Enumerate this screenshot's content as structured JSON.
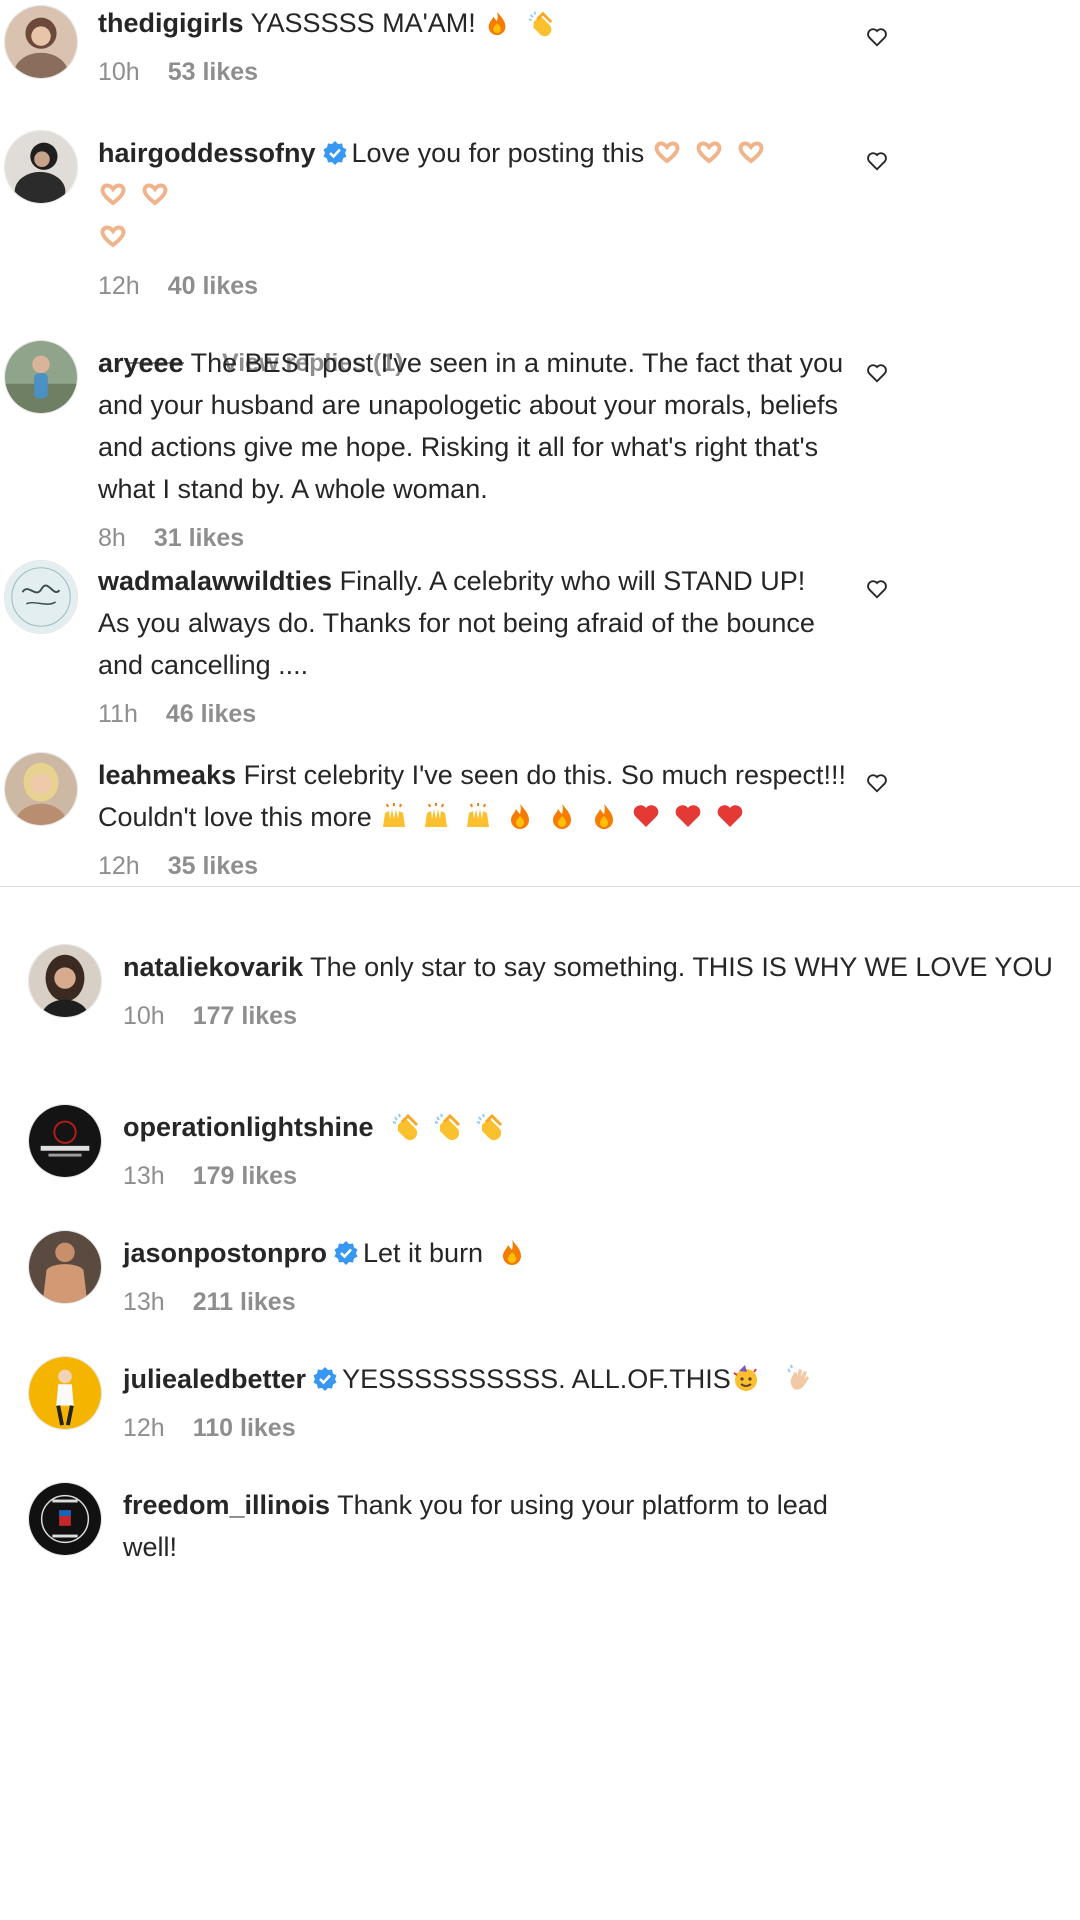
{
  "comments_top": [
    {
      "username": "thedigigirls",
      "verified": false,
      "text": "YASSSSS MA'AM!",
      "emojis": [
        "fire",
        "clap"
      ],
      "time": "10h",
      "likes": "53 likes",
      "avatar_icon": "avatar-woman-portrait"
    },
    {
      "username": "hairgoddessofny",
      "verified": true,
      "text": "Love you for posting this",
      "emojis": [
        "heart-hands",
        "heart-hands",
        "heart-hands",
        "heart-hands",
        "heart-hands",
        "heart-hands"
      ],
      "time": "12h",
      "likes": "40 likes",
      "avatar_icon": "avatar-woman-dark"
    },
    {
      "username": "aryeee",
      "verified": false,
      "text": "The BEST post I've seen in a minute. The fact that you and your husband are unapologetic about your morals, beliefs and actions give me hope. Risking it all for what's right that's what I stand by. A whole woman.",
      "emojis": [],
      "time": "8h",
      "likes": "31 likes",
      "avatar_icon": "avatar-outdoor"
    },
    {
      "username": "wadmalawwildties",
      "verified": false,
      "text": "Finally. A celebrity who will STAND UP! As you always do. Thanks for not being afraid of the bounce and cancelling ....",
      "emojis": [],
      "time": "11h",
      "likes": "46 likes",
      "avatar_icon": "avatar-script-logo"
    },
    {
      "username": "leahmeaks",
      "verified": false,
      "text": "First celebrity I've seen do this. So much respect!!! Couldn't love this more",
      "emojis": [
        "raised-hands",
        "raised-hands",
        "raised-hands",
        "fire",
        "fire",
        "fire",
        "red-heart",
        "red-heart",
        "red-heart"
      ],
      "time": "12h",
      "likes": "35 likes",
      "avatar_icon": "avatar-blonde"
    }
  ],
  "view_replies": "View replies (1)",
  "comments_bottom": [
    {
      "username": "nataliekovarik",
      "verified": false,
      "text": "The only star to say something. THIS IS WHY WE LOVE YOU",
      "emojis": [],
      "time": "10h",
      "likes": "177 likes",
      "avatar_icon": "avatar-woman-brunette"
    },
    {
      "username": "operationlightshine",
      "verified": false,
      "text": "",
      "emojis": [
        "clap",
        "clap",
        "clap"
      ],
      "time": "13h",
      "likes": "179 likes",
      "avatar_icon": "avatar-dark-logo"
    },
    {
      "username": "jasonpostonpro",
      "verified": true,
      "text": "Let it burn",
      "emojis": [
        "fire"
      ],
      "time": "13h",
      "likes": "211 likes",
      "avatar_icon": "avatar-man-shirtless"
    },
    {
      "username": "juliealedbetter",
      "verified": true,
      "text": "YESSSSSSSSSS. ALL.OF.THIS",
      "emojis": [
        "party-face",
        "waving-hand"
      ],
      "time": "12h",
      "likes": "110 likes",
      "avatar_icon": "avatar-yellow"
    },
    {
      "username": "freedom_illinois",
      "verified": false,
      "text": "Thank you for using your platform to lead well!",
      "emojis": [],
      "time": "",
      "likes": "",
      "avatar_icon": "avatar-freedom-illinois-logo"
    }
  ],
  "colors": {
    "text": "#262626",
    "meta": "#8e8e8e",
    "verified": "#3897f0",
    "divider": "#dbdbdb"
  }
}
